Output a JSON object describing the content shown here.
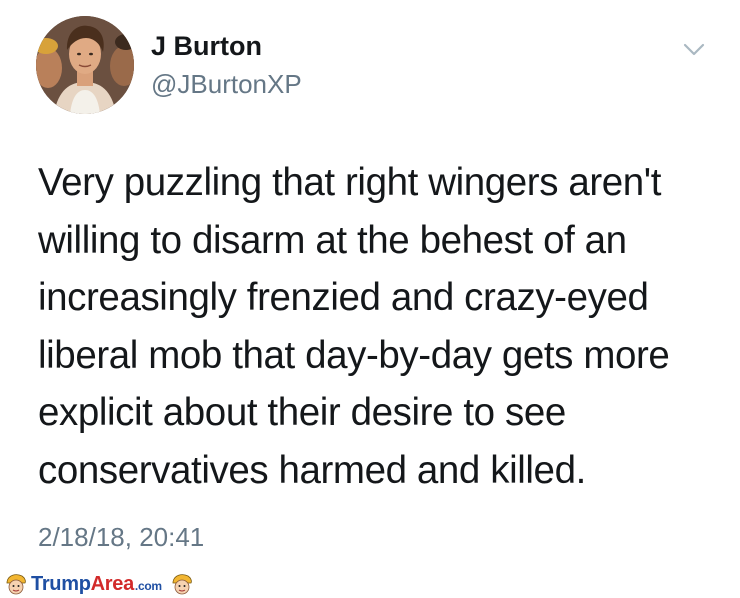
{
  "tweet": {
    "display_name": "J Burton",
    "handle": "@JBurtonXP",
    "text_lines": [
      "Very puzzling that right wingers aren't",
      "willing to disarm at the behest of an",
      "increasingly frenzied and crazy-eyed",
      "liberal mob that day-by-day gets more",
      "explicit about their desire to see",
      "conservatives harmed and killed."
    ],
    "timestamp": "2/18/18, 20:41",
    "caret_icon": "chevron-down-icon",
    "avatar_icon": "avatar"
  },
  "watermark": {
    "part1": "Trump",
    "part2": "Area",
    "suffix": ".com",
    "icon": "cartoon-face-icon"
  },
  "colors": {
    "text_primary": "#14171a",
    "text_secondary": "#657786",
    "caret": "#aab8c2",
    "watermark_blue": "#1f4fa3",
    "watermark_red": "#d22a2a"
  }
}
